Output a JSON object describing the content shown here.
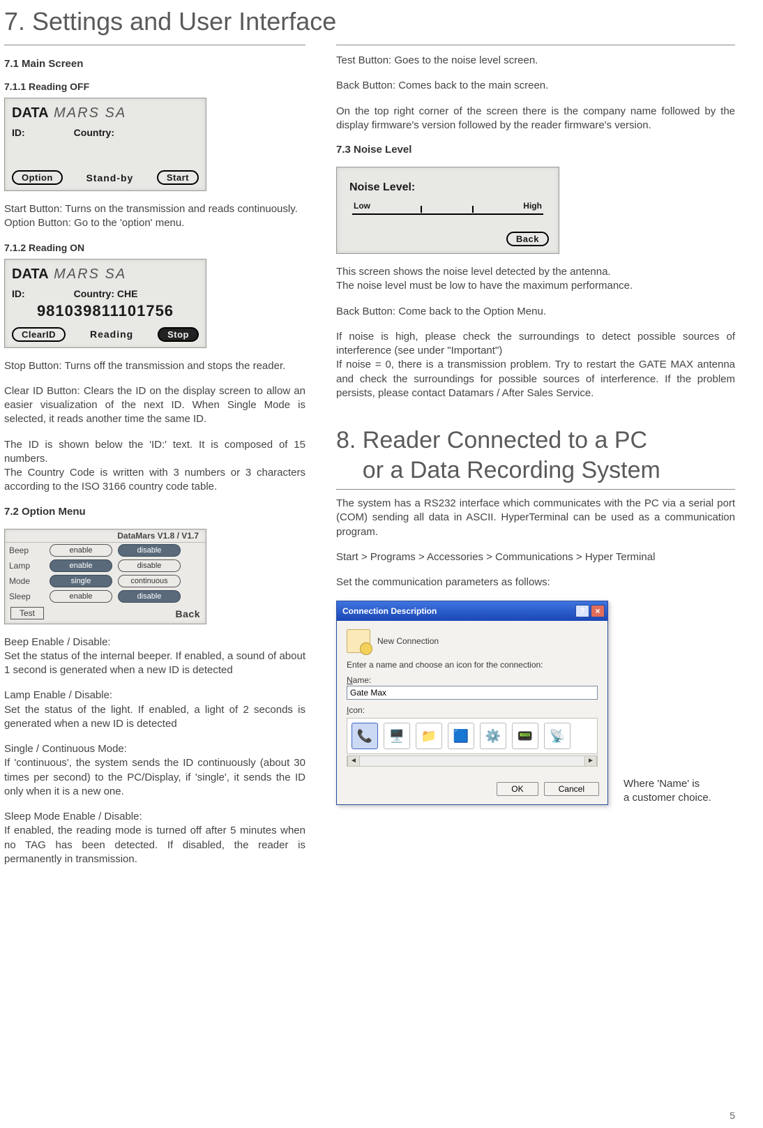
{
  "section7": {
    "title": "7.  Settings and User Interface"
  },
  "s71": {
    "heading": "7.1    Main Screen"
  },
  "s711": {
    "heading": "7.1.1 Reading OFF"
  },
  "lcd1": {
    "logo_bold": "DATA",
    "logo_light": " MARS SA",
    "id_label": "ID:",
    "country_label": "Country:",
    "btn_left": "Option",
    "status": "Stand-by",
    "btn_right": "Start"
  },
  "p711a": "Start Button: Turns on the transmission and reads continuously.",
  "p711b": "Option Button: Go to the 'option' menu.",
  "s712": {
    "heading": "7.1.2 Reading ON"
  },
  "lcd2": {
    "logo_bold": "DATA",
    "logo_light": " MARS SA",
    "id_label": "ID:",
    "country_label": "Country: CHE",
    "id_value": "981039811101756",
    "btn_left": "ClearID",
    "status": "Reading",
    "btn_right": "Stop"
  },
  "p712a": "Stop Button: Turns off the transmission and stops the reader.",
  "p712b": "Clear ID Button: Clears the ID on the display screen to allow an easier visualization of the next ID. When Single Mode is selected, it reads another time the same ID.",
  "p712c": "The ID is shown below the 'ID:' text. It is composed of 15 numbers.",
  "p712d": "The Country Code is written with 3 numbers or 3 characters according to the ISO 3166 country code table.",
  "s72": {
    "heading": "7.2    Option Menu"
  },
  "optmenu": {
    "header": "DataMars V1.8 / V1.7",
    "rows": [
      {
        "label": "Beep",
        "opt1": "enable",
        "opt2": "disable",
        "sel": 2
      },
      {
        "label": "Lamp",
        "opt1": "enable",
        "opt2": "disable",
        "sel": 1
      },
      {
        "label": "Mode",
        "opt1": "single",
        "opt2": "continuous",
        "sel": 1
      },
      {
        "label": "Sleep",
        "opt1": "enable",
        "opt2": "disable",
        "sel": 2
      }
    ],
    "btn_test": "Test",
    "btn_back": "Back"
  },
  "p72a_t": "Beep Enable / Disable:",
  "p72a": "Set the status of the internal beeper. If enabled, a sound of about 1 second is generated when a new ID is detected",
  "p72b_t": "Lamp Enable / Disable:",
  "p72b": "Set the status of the light. If enabled, a light of 2 seconds is generated when a new ID is detected",
  "p72c_t": "Single / Continuous Mode:",
  "p72c": "If 'continuous', the system sends the ID continuously (about 30 times per second) to the PC/Display, if 'single', it sends the ID only when it is a new one.",
  "p72d_t": "Sleep Mode Enable / Disable:",
  "p72d": "If enabled, the reading mode is turned off after 5 minutes when no TAG has been detected. If disabled, the reader is permanently in transmission.",
  "pr1": "Test Button: Goes to the noise level screen.",
  "pr2": "Back Button: Comes back to the main screen.",
  "pr3": "On the top right corner of the screen there is the company name followed by the display firmware's version followed by the reader firmware's version.",
  "s73": {
    "heading": "7.3    Noise Level"
  },
  "lcd3": {
    "title": "Noise Level:",
    "low": "Low",
    "high": "High",
    "btn_back": "Back"
  },
  "p73a": "This screen shows the noise level detected by the antenna.",
  "p73b": "The noise level must be low to have the maximum performance.",
  "p73c": "Back Button: Come back to the Option Menu.",
  "p73d": "If noise is high, please check the surroundings to detect possible sources of interference (see under \"Important\")",
  "p73e": "If noise = 0, there is a transmission problem. Try to restart the GATE MAX antenna and check the surroundings for possible sources of interference. If the problem persists, please contact Datamars / After Sales Service.",
  "section8": {
    "line1": "8. Reader Connected to a PC",
    "line2": "    or a Data Recording System"
  },
  "p8a": "The system has a RS232 interface which communicates with the PC via a serial port (COM) sending all data in ASCII.  HyperTerminal can be used as a communication program.",
  "p8b": "Start > Programs > Accessories > Communications > Hyper Terminal",
  "p8c": "Set the communication parameters as follows:",
  "dialog": {
    "title": "Connection Description",
    "help": "?",
    "close": "×",
    "new_conn": "New Connection",
    "prompt": "Enter a name and choose an icon for the connection:",
    "name_label": "Name:",
    "name_value": "Gate Max",
    "icon_label": "Icon:",
    "btn_ok": "OK",
    "btn_cancel": "Cancel"
  },
  "side_note1": "Where 'Name' is",
  "side_note2": "a customer choice.",
  "page_number": "5"
}
